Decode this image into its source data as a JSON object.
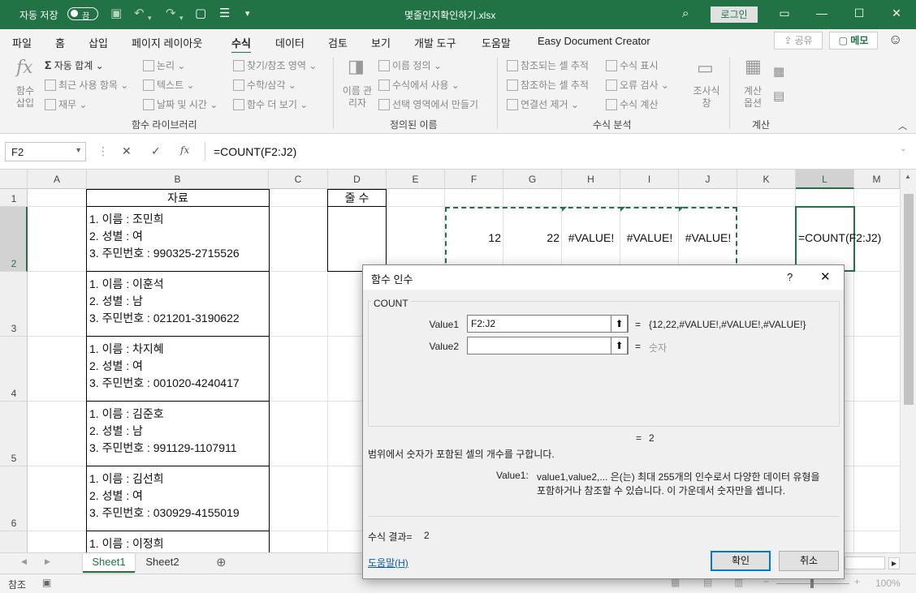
{
  "titlebar": {
    "autosave_label": "자동 저장",
    "toggle_state": "끔",
    "filename": "몇줄인지확인하기.xlsx",
    "login": "로그인"
  },
  "menu": {
    "tabs": [
      "파일",
      "홈",
      "삽입",
      "페이지 레이아웃",
      "수식",
      "데이터",
      "검토",
      "보기",
      "개발 도구",
      "도움말",
      "Easy Document Creator"
    ],
    "active": "수식",
    "share": "공유",
    "memo": "메모"
  },
  "ribbon": {
    "insert_function": "함수 삽입",
    "autosum": "자동 합계",
    "recent": "최근 사용 항목",
    "financial": "재무",
    "logical": "논리",
    "text": "텍스트",
    "datetime": "날짜 및 시간",
    "lookup": "찾기/참조 영역",
    "math": "수학/삼각",
    "more": "함수 더 보기",
    "group_library": "함수 라이브러리",
    "name_manager": "이름 관리자",
    "define_name": "이름 정의",
    "use_in_formula": "수식에서 사용",
    "create_from_sel": "선택 영역에서 만들기",
    "group_names": "정의된 이름",
    "trace_precedents": "참조되는 셀 추적",
    "trace_dependents": "참조하는 셀 추적",
    "remove_arrows": "연결선 제거",
    "show_formulas": "수식 표시",
    "error_checking": "오류 검사",
    "evaluate": "수식 계산",
    "watch": "조사식 창",
    "group_audit": "수식 분석",
    "calc_options": "계산 옵션",
    "group_calc": "계산"
  },
  "formula_bar": {
    "namebox": "F2",
    "formula": "=COUNT(F2:J2)"
  },
  "columns": [
    "A",
    "B",
    "C",
    "D",
    "E",
    "F",
    "G",
    "H",
    "I",
    "J",
    "K",
    "L",
    "M"
  ],
  "rows": [
    "1",
    "2",
    "3",
    "4",
    "5",
    "6"
  ],
  "cells": {
    "b1": "자료",
    "d1": "줄 수",
    "records": [
      [
        "1. 이름 : 조민희",
        "2. 성별 : 여",
        "3. 주민번호 : 990325-2715526"
      ],
      [
        "1. 이름 : 이훈석",
        "2. 성별 : 남",
        "3. 주민번호 : 021201-3190622"
      ],
      [
        "1. 이름 : 차지혜",
        "2. 성별 : 여",
        "3. 주민번호 : 001020-4240417"
      ],
      [
        "1. 이름 : 김준호",
        "2. 성별 : 남",
        "3. 주민번호 : 991129-1107911"
      ],
      [
        "1. 이름 : 김선희",
        "2. 성별 : 여",
        "3. 주민번호 : 030929-4155019"
      ],
      [
        "1. 이름 : 이정희"
      ]
    ],
    "f2": "12",
    "g2": "22",
    "h2": "#VALUE!",
    "i2": "#VALUE!",
    "j2": "#VALUE!",
    "l2": "=COUNT(F2:J2)"
  },
  "sheets": [
    "Sheet1",
    "Sheet2"
  ],
  "status": {
    "mode": "참조",
    "zoom": "100%"
  },
  "dialog": {
    "title": "함수 인수",
    "help_q": "?",
    "fn": "COUNT",
    "arg1_label": "Value1",
    "arg1_value": "F2:J2",
    "arg1_result": "{12,22,#VALUE!,#VALUE!,#VALUE!}",
    "arg2_label": "Value2",
    "arg2_value": "",
    "arg2_result": "숫자",
    "eq": "=",
    "result": "2",
    "description": "범위에서 숫자가 포함된 셀의 개수를 구합니다.",
    "arg_help_label": "Value1:",
    "arg_help_1": "value1,value2,... 은(는) 최대 255개의 인수로서 다양한 데이터 유형을",
    "arg_help_2": "포함하거나 참조할 수 있습니다. 이 가운데서 숫자만을 셉니다.",
    "formula_result_label": "수식 결과=",
    "formula_result": "2",
    "help_link": "도움말(H)",
    "ok": "확인",
    "cancel": "취소"
  }
}
